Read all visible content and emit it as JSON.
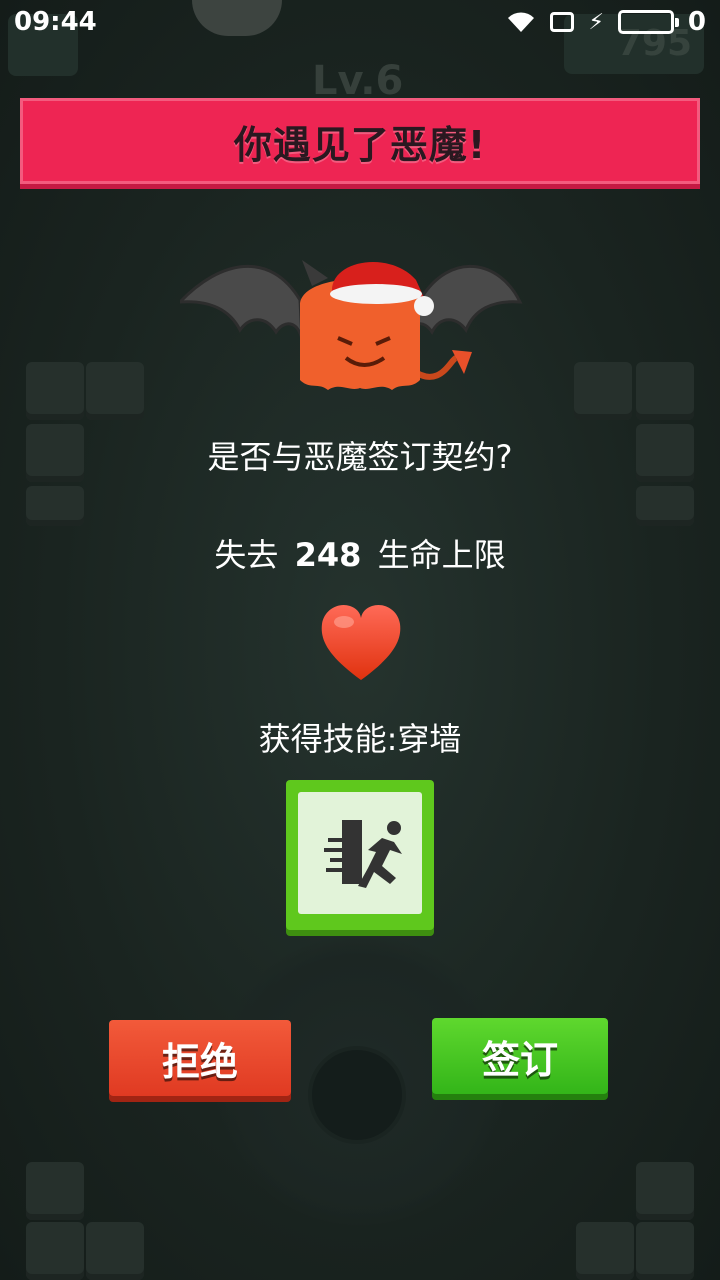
{
  "status_bar": {
    "time": "09:44",
    "battery_level": "0"
  },
  "hud": {
    "level": "Lv.6",
    "coins": "795"
  },
  "banner": {
    "title": "你遇见了恶魔!"
  },
  "dialog": {
    "question": "是否与恶魔签订契约?",
    "cost_prefix": "失去",
    "cost_value": "248",
    "cost_suffix": "生命上限",
    "skill_text": "获得技能:穿墙"
  },
  "buttons": {
    "refuse": "拒绝",
    "sign": "签订"
  },
  "colors": {
    "banner": "#ee2553",
    "refuse": "#e03a22",
    "sign": "#33b519",
    "skill_frame": "#5fc81d"
  }
}
